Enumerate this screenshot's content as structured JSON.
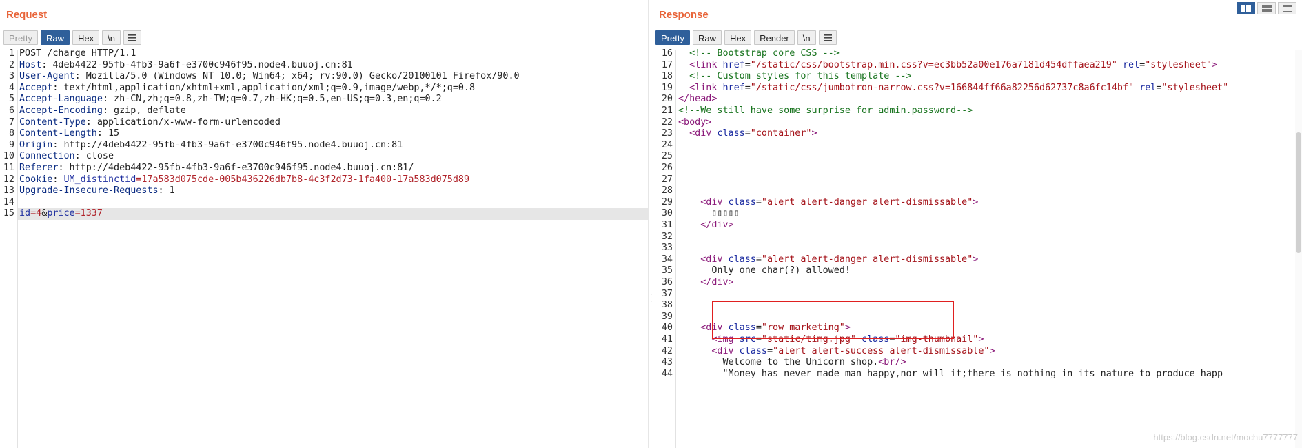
{
  "request": {
    "title": "Request",
    "tabs": [
      {
        "label": "Pretty",
        "state": "disabled"
      },
      {
        "label": "Raw",
        "state": "active"
      },
      {
        "label": "Hex",
        "state": "normal"
      },
      {
        "label": "\\n",
        "state": "normal"
      }
    ],
    "menu_icon": "hamburger-menu-icon",
    "lines": [
      {
        "n": "1",
        "parts": [
          {
            "t": "POST /charge HTTP/1.1",
            "c": "v"
          }
        ]
      },
      {
        "n": "2",
        "parts": [
          {
            "t": "Host",
            "c": "k"
          },
          {
            "t": ": 4deb4422-95fb-4fb3-9a6f-e3700c946f95.node4.buuoj.cn:81",
            "c": "v"
          }
        ]
      },
      {
        "n": "3",
        "parts": [
          {
            "t": "User-Agent",
            "c": "k"
          },
          {
            "t": ": Mozilla/5.0 (Windows NT 10.0; Win64; x64; rv:90.0) Gecko/20100101 Firefox/90.0",
            "c": "v"
          }
        ]
      },
      {
        "n": "4",
        "parts": [
          {
            "t": "Accept",
            "c": "k"
          },
          {
            "t": ": text/html,application/xhtml+xml,application/xml;q=0.9,image/webp,*/*;q=0.8",
            "c": "v"
          }
        ]
      },
      {
        "n": "5",
        "parts": [
          {
            "t": "Accept-Language",
            "c": "k"
          },
          {
            "t": ": zh-CN,zh;q=0.8,zh-TW;q=0.7,zh-HK;q=0.5,en-US;q=0.3,en;q=0.2",
            "c": "v"
          }
        ]
      },
      {
        "n": "6",
        "parts": [
          {
            "t": "Accept-Encoding",
            "c": "k"
          },
          {
            "t": ": gzip, deflate",
            "c": "v"
          }
        ]
      },
      {
        "n": "7",
        "parts": [
          {
            "t": "Content-Type",
            "c": "k"
          },
          {
            "t": ": application/x-www-form-urlencoded",
            "c": "v"
          }
        ]
      },
      {
        "n": "8",
        "parts": [
          {
            "t": "Content-Length",
            "c": "k"
          },
          {
            "t": ": 15",
            "c": "v"
          }
        ]
      },
      {
        "n": "9",
        "parts": [
          {
            "t": "Origin",
            "c": "k"
          },
          {
            "t": ": http://4deb4422-95fb-4fb3-9a6f-e3700c946f95.node4.buuoj.cn:81",
            "c": "v"
          }
        ]
      },
      {
        "n": "10",
        "parts": [
          {
            "t": "Connection",
            "c": "k"
          },
          {
            "t": ": close",
            "c": "v"
          }
        ]
      },
      {
        "n": "11",
        "parts": [
          {
            "t": "Referer",
            "c": "k"
          },
          {
            "t": ": http://4deb4422-95fb-4fb3-9a6f-e3700c946f95.node4.buuoj.cn:81/",
            "c": "v"
          }
        ]
      },
      {
        "n": "12",
        "parts": [
          {
            "t": "Cookie",
            "c": "k"
          },
          {
            "t": ": ",
            "c": "v"
          },
          {
            "t": "UM_distinctid",
            "c": "blue"
          },
          {
            "t": "=17a583d075cde-005b436226db7b8-4c3f2d73-1fa400-17a583d075d89",
            "c": "red"
          }
        ]
      },
      {
        "n": "13",
        "parts": [
          {
            "t": "Upgrade-Insecure-Requests",
            "c": "k"
          },
          {
            "t": ": 1",
            "c": "v"
          }
        ]
      },
      {
        "n": "14",
        "parts": []
      },
      {
        "n": "15",
        "parts": [
          {
            "t": "id",
            "c": "blue"
          },
          {
            "t": "=4",
            "c": "red"
          },
          {
            "t": "&",
            "c": "v"
          },
          {
            "t": "price",
            "c": "blue"
          },
          {
            "t": "=1337",
            "c": "red"
          }
        ],
        "highlight": true
      }
    ]
  },
  "response": {
    "title": "Response",
    "tabs": [
      {
        "label": "Pretty",
        "state": "active"
      },
      {
        "label": "Raw",
        "state": "normal"
      },
      {
        "label": "Hex",
        "state": "normal"
      },
      {
        "label": "Render",
        "state": "normal"
      },
      {
        "label": "\\n",
        "state": "normal"
      }
    ],
    "menu_icon": "hamburger-menu-icon",
    "lines": [
      {
        "n": "16",
        "i": 2,
        "parts": [
          {
            "t": "<!-- Bootstrap core CSS -->",
            "c": "cmt"
          }
        ]
      },
      {
        "n": "17",
        "i": 2,
        "parts": [
          {
            "t": "<link ",
            "c": "tag"
          },
          {
            "t": "href",
            "c": "attr"
          },
          {
            "t": "=",
            "c": "v"
          },
          {
            "t": "\"/static/css/bootstrap.min.css?v=ec3bb52a00e176a7181d454dffaea219\"",
            "c": "str"
          },
          {
            "t": " rel",
            "c": "attr"
          },
          {
            "t": "=",
            "c": "v"
          },
          {
            "t": "\"stylesheet\"",
            "c": "str"
          },
          {
            "t": ">",
            "c": "tag"
          }
        ]
      },
      {
        "n": "18",
        "i": 2,
        "parts": [
          {
            "t": "<!-- Custom styles for this template -->",
            "c": "cmt"
          }
        ]
      },
      {
        "n": "19",
        "i": 2,
        "parts": [
          {
            "t": "<link ",
            "c": "tag"
          },
          {
            "t": "href",
            "c": "attr"
          },
          {
            "t": "=",
            "c": "v"
          },
          {
            "t": "\"/static/css/jumbotron-narrow.css?v=166844ff66a82256d62737c8a6fc14bf\"",
            "c": "str"
          },
          {
            "t": " rel",
            "c": "attr"
          },
          {
            "t": "=",
            "c": "v"
          },
          {
            "t": "\"stylesheet\"",
            "c": "str"
          }
        ]
      },
      {
        "n": "20",
        "i": 0,
        "parts": [
          {
            "t": "</head>",
            "c": "tag"
          }
        ]
      },
      {
        "n": "21",
        "i": 0,
        "parts": [
          {
            "t": "<!--We still have some surprise for admin.password-->",
            "c": "cmt"
          }
        ]
      },
      {
        "n": "22",
        "i": 0,
        "parts": [
          {
            "t": "<body>",
            "c": "tag"
          }
        ]
      },
      {
        "n": "23",
        "i": 2,
        "parts": [
          {
            "t": "<div ",
            "c": "tag"
          },
          {
            "t": "class",
            "c": "attr"
          },
          {
            "t": "=",
            "c": "v"
          },
          {
            "t": "\"container\"",
            "c": "str"
          },
          {
            "t": ">",
            "c": "tag"
          }
        ]
      },
      {
        "n": "24",
        "i": 0,
        "parts": []
      },
      {
        "n": "25",
        "i": 0,
        "parts": []
      },
      {
        "n": "26",
        "i": 0,
        "parts": []
      },
      {
        "n": "27",
        "i": 0,
        "parts": []
      },
      {
        "n": "28",
        "i": 0,
        "parts": []
      },
      {
        "n": "29",
        "i": 4,
        "parts": [
          {
            "t": "<div ",
            "c": "tag"
          },
          {
            "t": "class",
            "c": "attr"
          },
          {
            "t": "=",
            "c": "v"
          },
          {
            "t": "\"alert alert-danger alert-dismissable\"",
            "c": "str"
          },
          {
            "t": ">",
            "c": "tag"
          }
        ]
      },
      {
        "n": "30",
        "i": 6,
        "parts": [
          {
            "t": "▯▯▯▯▯",
            "c": "v"
          }
        ]
      },
      {
        "n": "31",
        "i": 4,
        "parts": [
          {
            "t": "</div>",
            "c": "tag"
          }
        ]
      },
      {
        "n": "32",
        "i": 0,
        "parts": []
      },
      {
        "n": "33",
        "i": 0,
        "parts": []
      },
      {
        "n": "34",
        "i": 4,
        "parts": [
          {
            "t": "<div ",
            "c": "tag"
          },
          {
            "t": "class",
            "c": "attr"
          },
          {
            "t": "=",
            "c": "v"
          },
          {
            "t": "\"alert alert-danger alert-dismissable\"",
            "c": "str"
          },
          {
            "t": ">",
            "c": "tag"
          }
        ]
      },
      {
        "n": "35",
        "i": 6,
        "parts": [
          {
            "t": "Only one char(?) allowed!",
            "c": "v"
          }
        ]
      },
      {
        "n": "36",
        "i": 4,
        "parts": [
          {
            "t": "</div>",
            "c": "tag"
          }
        ]
      },
      {
        "n": "37",
        "i": 0,
        "parts": []
      },
      {
        "n": "38",
        "i": 0,
        "parts": []
      },
      {
        "n": "39",
        "i": 0,
        "parts": []
      },
      {
        "n": "40",
        "i": 4,
        "parts": [
          {
            "t": "<div ",
            "c": "tag"
          },
          {
            "t": "class",
            "c": "attr"
          },
          {
            "t": "=",
            "c": "v"
          },
          {
            "t": "\"row marketing\"",
            "c": "str"
          },
          {
            "t": ">",
            "c": "tag"
          }
        ]
      },
      {
        "n": "41",
        "i": 6,
        "parts": [
          {
            "t": "<img ",
            "c": "tag"
          },
          {
            "t": "src",
            "c": "attr"
          },
          {
            "t": "=",
            "c": "v"
          },
          {
            "t": "\"static/timg.jpg\"",
            "c": "str"
          },
          {
            "t": " class",
            "c": "attr"
          },
          {
            "t": "=",
            "c": "v"
          },
          {
            "t": "\"img-thumbnail\"",
            "c": "str"
          },
          {
            "t": ">",
            "c": "tag"
          }
        ]
      },
      {
        "n": "42",
        "i": 6,
        "parts": [
          {
            "t": "<div ",
            "c": "tag"
          },
          {
            "t": "class",
            "c": "attr"
          },
          {
            "t": "=",
            "c": "v"
          },
          {
            "t": "\"alert alert-success alert-dismissable\"",
            "c": "str"
          },
          {
            "t": ">",
            "c": "tag"
          }
        ]
      },
      {
        "n": "43",
        "i": 8,
        "parts": [
          {
            "t": "Welcome to the Unicorn shop.",
            "c": "v"
          },
          {
            "t": "<br/>",
            "c": "tag"
          }
        ]
      },
      {
        "n": "44",
        "i": 8,
        "parts": [
          {
            "t": "\"Money has never made man happy,nor will it;there is nothing in its nature to produce happ",
            "c": "v"
          }
        ]
      }
    ]
  },
  "layout_buttons": [
    "split-vertical-icon",
    "split-horizontal-icon",
    "tabs-icon"
  ],
  "watermark": "https://blog.csdn.net/mochu7777777"
}
